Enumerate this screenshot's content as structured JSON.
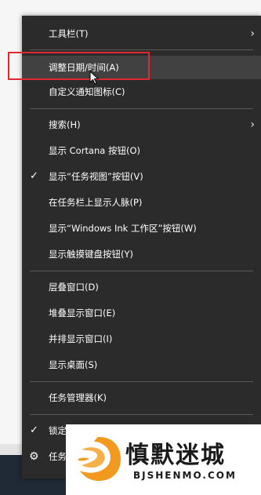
{
  "menu": {
    "items": [
      {
        "label": "工具栏(T)",
        "submenu": true
      },
      {
        "label": "调整日期/时间(A)",
        "hover": true
      },
      {
        "label": "自定义通知图标(C)"
      },
      {
        "label": "搜索(H)",
        "submenu": true
      },
      {
        "label": "显示 Cortana 按钮(O)"
      },
      {
        "label": "显示“任务视图”按钮(V)",
        "checked": true
      },
      {
        "label": "在任务栏上显示人脉(P)"
      },
      {
        "label": "显示“Windows Ink 工作区”按钮(W)"
      },
      {
        "label": "显示触摸键盘按钮(Y)"
      },
      {
        "label": "层叠窗口(D)"
      },
      {
        "label": "堆叠显示窗口(E)"
      },
      {
        "label": "并排显示窗口(I)"
      },
      {
        "label": "显示桌面(S)"
      },
      {
        "label": "任务管理器(K)"
      },
      {
        "label": "锁定",
        "checked": true
      },
      {
        "label": "任务",
        "icon": "gear-icon"
      }
    ],
    "check_glyph": "✓",
    "gear_glyph": "⚙",
    "chevron_glyph": "›"
  },
  "watermark": {
    "title": "慎默迷城",
    "url": "BJSHENMO.COM"
  },
  "colors": {
    "menu_bg": "#2b2b2b",
    "hover_bg": "#414141",
    "separator": "#5a5a5a",
    "highlight_box": "#e0282e",
    "watermark_orange": "#f29a1f",
    "taskbar": "#1f2a36"
  }
}
